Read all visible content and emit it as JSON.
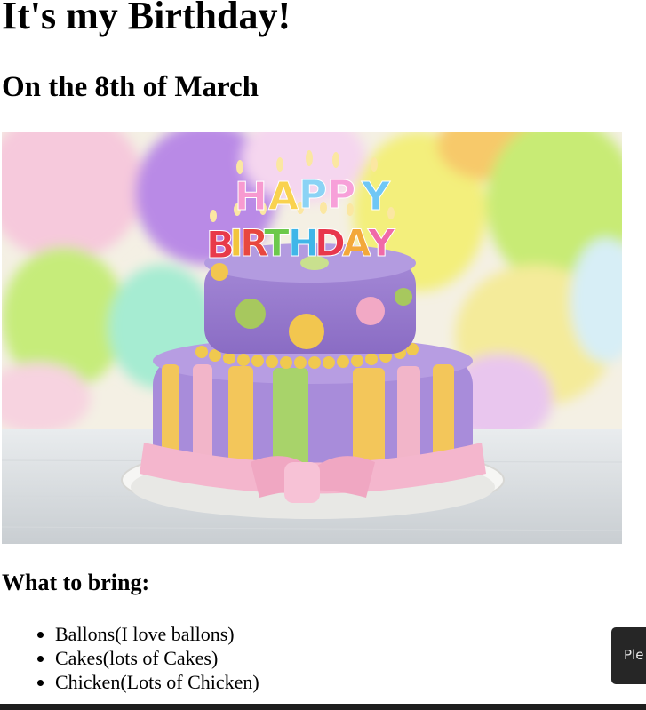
{
  "header": {
    "title": "It's my Birthday!",
    "subtitle": "On the 8th of March"
  },
  "photo": {
    "candle_letters_top": "HAPPY",
    "candle_letters_bottom": "BIRTHDAY"
  },
  "bring_section": {
    "heading": "What to bring:",
    "items": [
      "Ballons(I love ballons)",
      "Cakes(lots of Cakes)",
      "Chicken(Lots of Chicken)"
    ]
  },
  "toast": {
    "text": "Ple"
  },
  "colors": {
    "toast_background": "#262626",
    "bottom_bar": "#1e1e1e"
  }
}
